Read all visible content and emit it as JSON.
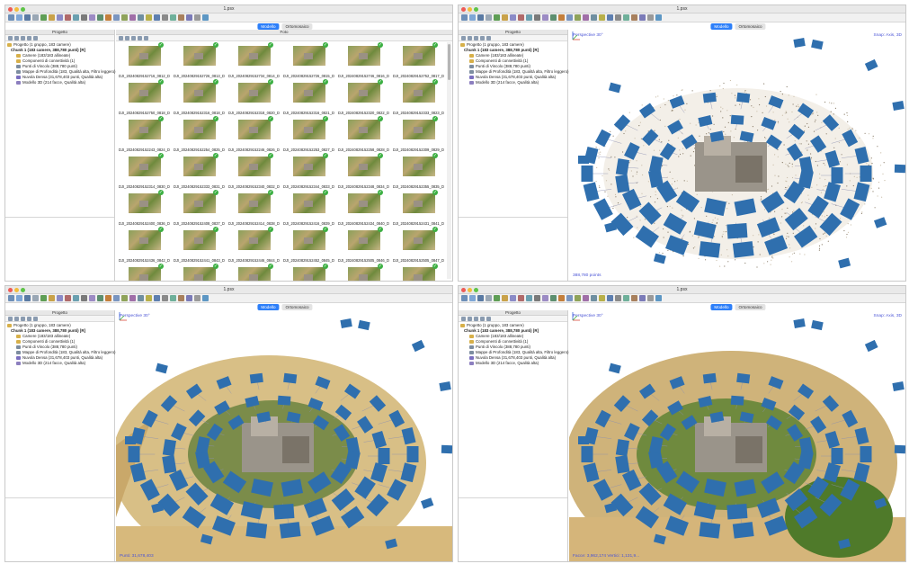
{
  "window_title": "1.psx",
  "tabs": [
    "Modello",
    "Ortomosaico"
  ],
  "panels": {
    "workspace": "Progetto",
    "photos": "Foto"
  },
  "tree": {
    "root": "Progetto (1 gruppo, 183 camere)",
    "chunk": "Chunk 1 (183 camere, 388,780 punti) [R]",
    "items": [
      "Camere (183/183 allineate)",
      "Componenti di connettività (1)",
      "Punti di Vincolo (388,780 punti)",
      "Mappe di Profondità (183, Qualità alta, Filtro leggero)",
      "Nuvola Densa (31,678,403 punti, Qualità alta)",
      "Modello 3D (214 facce, Qualità alta)"
    ]
  },
  "photos": [
    "DJI_20240829152716_0812_D",
    "DJI_20240829152726_0813_D",
    "DJI_20240829152734_0814_D",
    "DJI_20240829152726_0815_D",
    "DJI_20240829152746_0816_D",
    "DJI_20240829152752_0817_D",
    "DJI_20240829152750_0818_D",
    "DJI_20240829152316_0818_D",
    "DJI_20240829152318_0820_D",
    "DJI_20240829152316_0821_D",
    "DJI_20240829152320_0822_D",
    "DJI_20240829152333_0823_D",
    "DJI_20240829152243_0824_D",
    "DJI_20240829152254_0825_D",
    "DJI_20240829152246_0826_D",
    "DJI_20240829152253_0827_D",
    "DJI_20240829152258_0828_D",
    "DJI_20240829152309_0829_D",
    "DJI_20240829152314_0830_D",
    "DJI_20240829152333_0831_D",
    "DJI_20240829152340_0832_D",
    "DJI_20240829152344_0833_D",
    "DJI_20240829152348_0834_D",
    "DJI_20240829152355_0835_D",
    "DJI_20240829152400_0836_D",
    "DJI_20240829152408_0837_D",
    "DJI_20240829152414_0838_D",
    "DJI_20240829152416_0839_D",
    "DJI_20240829152434_0840_D",
    "DJI_20240829152431_0841_D",
    "DJI_20240829152436_0842_D",
    "DJI_20240829152441_0843_D",
    "DJI_20240829152446_0844_D",
    "DJI_20240829152452_0845_D",
    "DJI_20240829152505_0846_D",
    "DJI_20240829152505_0847_D",
    "",
    "",
    "",
    "",
    "",
    ""
  ],
  "views": [
    {
      "perspective": "Perspective 30°",
      "snap": "Snap: Axis, 3D",
      "status": "388,780 points"
    },
    {
      "perspective": "Perspective 30°",
      "snap": "",
      "status": "Punti: 31,678,403"
    },
    {
      "perspective": "Perspective 30°",
      "snap": "Snap: Axis, 3D",
      "status": "Facce: 3,962,174 Vertici: 1,131,9..."
    }
  ],
  "colors": {
    "accent": "#2d7ff9",
    "camera_blue": "#2f6fae",
    "viewport_text": "#4a54d6",
    "check_green": "#3cb043"
  }
}
